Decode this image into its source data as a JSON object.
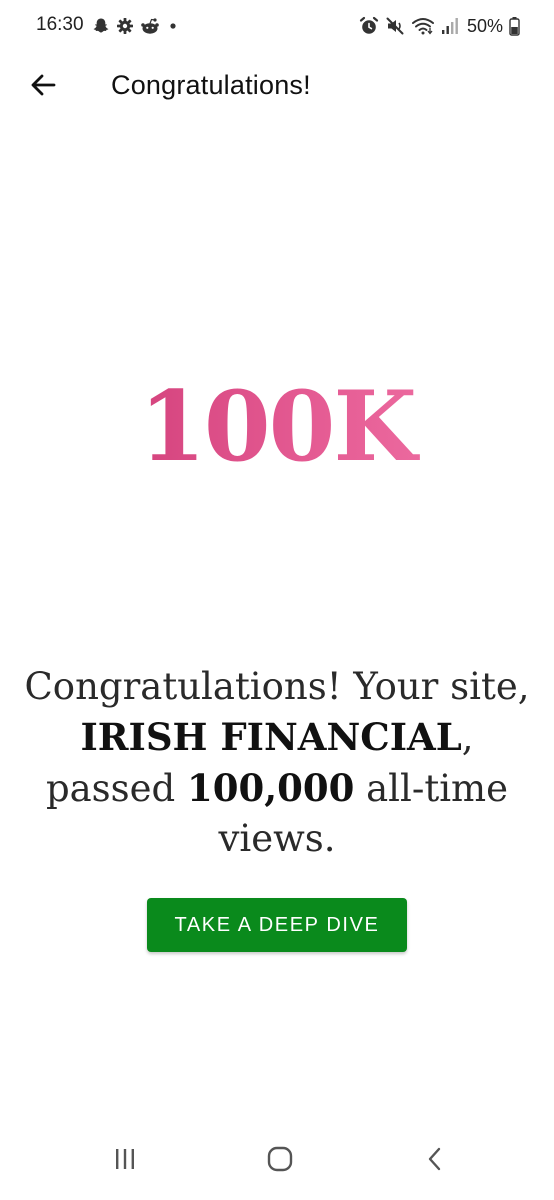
{
  "status_bar": {
    "time": "16:30",
    "battery": "50%",
    "left_icons": [
      "snapchat-icon",
      "settings-icon",
      "reddit-icon",
      "dot-icon"
    ],
    "right_icons": [
      "alarm-icon",
      "mute-icon",
      "wifi-icon",
      "signal-icon",
      "battery-icon"
    ]
  },
  "app_bar": {
    "title": "Congratulations!"
  },
  "milestone": {
    "badge": "100K",
    "colors": [
      "#c9326e",
      "#f47aac"
    ]
  },
  "message": {
    "prefix": "Congratulations! Your site, ",
    "site_name": "IRISH FINANCIAL",
    "middle": ", passed ",
    "views": "100,000",
    "suffix": " all-time views."
  },
  "cta": {
    "label": "TAKE A DEEP DIVE",
    "color": "#0a8a1c"
  },
  "nav_bar": {
    "buttons": [
      "recents-icon",
      "home-icon",
      "back-icon"
    ]
  }
}
